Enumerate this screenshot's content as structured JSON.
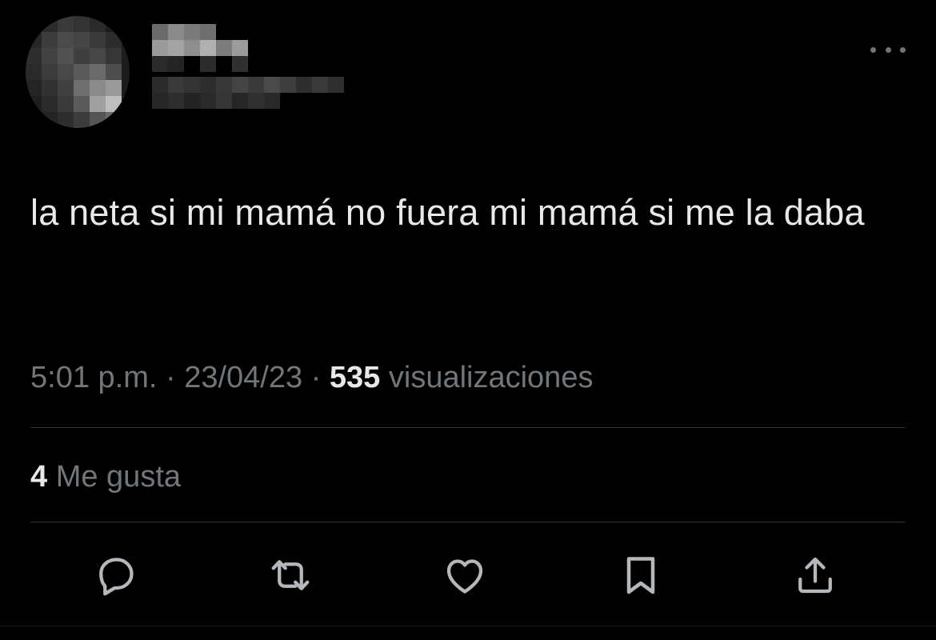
{
  "tweet": {
    "text": "la neta si mi mamá no fuera mi mamá si me la daba",
    "time": "5:01 p.m.",
    "separator": "·",
    "date": "23/04/23",
    "views_count": "535",
    "views_label": "visualizaciones",
    "likes_count": "4",
    "likes_label": "Me gusta"
  },
  "icons": {
    "more": "more-horizontal-icon",
    "reply": "reply-icon",
    "retweet": "retweet-icon",
    "like": "heart-icon",
    "bookmark": "bookmark-icon",
    "share": "share-icon"
  },
  "colors": {
    "background": "#000000",
    "primary_text": "#e7e9ea",
    "secondary_text": "#71767b",
    "divider": "#2f3336"
  }
}
